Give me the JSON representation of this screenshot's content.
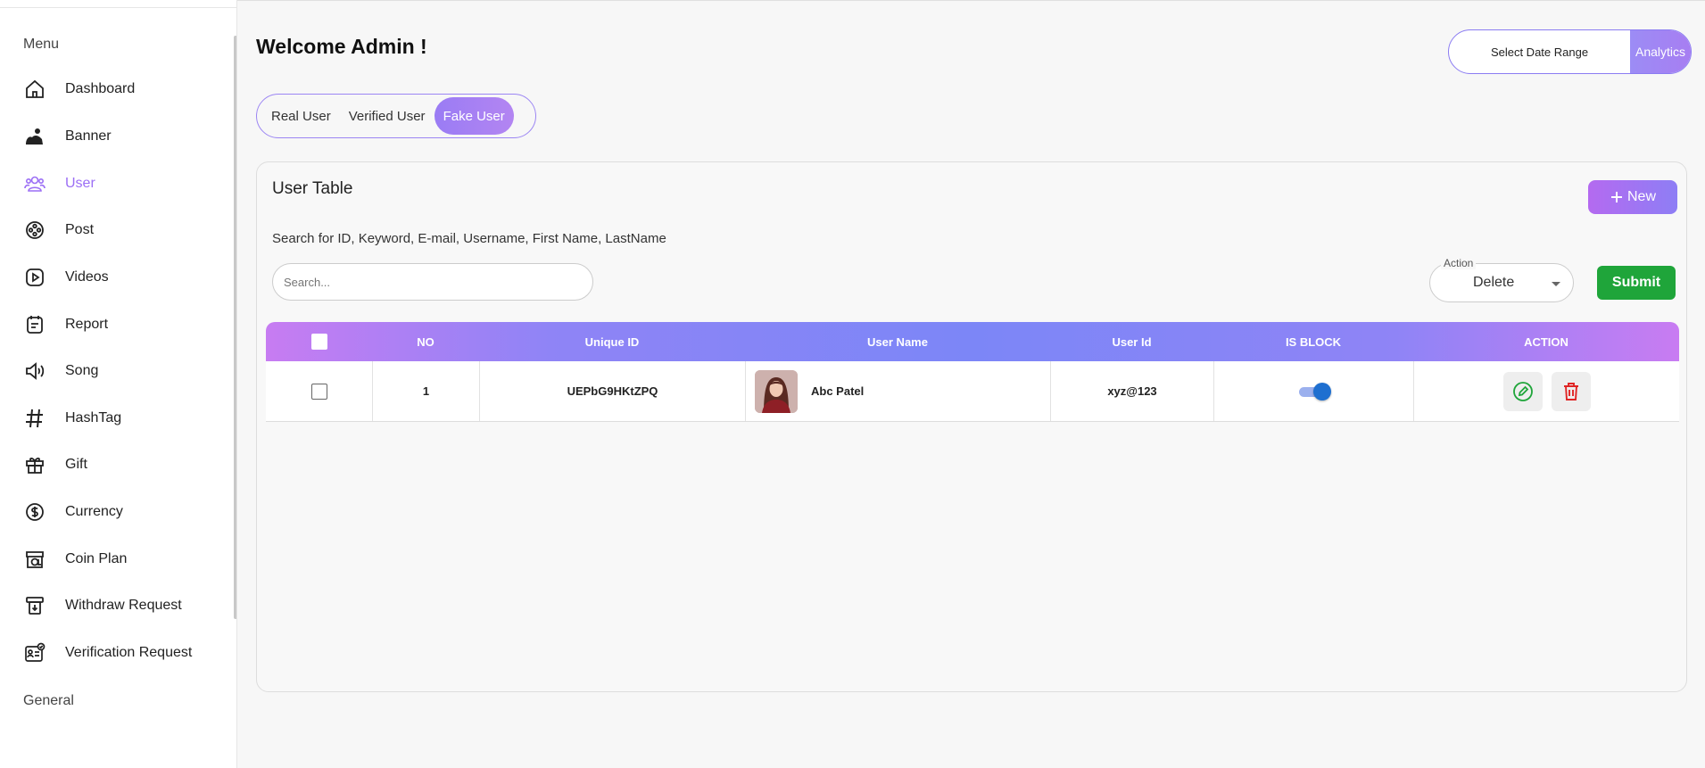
{
  "sidebar": {
    "menu_label": "Menu",
    "general_label": "General",
    "items": [
      {
        "label": "Dashboard",
        "icon": "home-icon"
      },
      {
        "label": "Banner",
        "icon": "image-icon"
      },
      {
        "label": "User",
        "icon": "users-icon",
        "active": true
      },
      {
        "label": "Post",
        "icon": "film-reel-icon"
      },
      {
        "label": "Videos",
        "icon": "play-icon"
      },
      {
        "label": "Report",
        "icon": "report-icon"
      },
      {
        "label": "Song",
        "icon": "speaker-icon"
      },
      {
        "label": "HashTag",
        "icon": "hashtag-icon"
      },
      {
        "label": "Gift",
        "icon": "gift-icon"
      },
      {
        "label": "Currency",
        "icon": "dollar-icon"
      },
      {
        "label": "Coin Plan",
        "icon": "coin-plan-icon"
      },
      {
        "label": "Withdraw Request",
        "icon": "withdraw-icon"
      },
      {
        "label": "Verification Request",
        "icon": "id-card-icon"
      }
    ]
  },
  "header": {
    "title": "Welcome Admin !",
    "date_range_label": "Select Date Range",
    "analytics_label": "Analytics"
  },
  "tabs": [
    {
      "label": "Real User",
      "active": false
    },
    {
      "label": "Verified User",
      "active": false
    },
    {
      "label": "Fake User",
      "active": true
    }
  ],
  "table_card": {
    "title": "User Table",
    "new_button": "New",
    "search_hint": "Search for ID, Keyword, E-mail, Username, First Name, LastName",
    "search_placeholder": "Search...",
    "action_label": "Action",
    "action_value": "Delete",
    "submit_label": "Submit",
    "columns": [
      "NO",
      "Unique ID",
      "User Name",
      "User Id",
      "IS BLOCK",
      "ACTION"
    ],
    "rows": [
      {
        "no": "1",
        "unique_id": "UEPbG9HKtZPQ",
        "user_name": "Abc Patel",
        "user_id": "xyz@123",
        "is_block": true
      }
    ]
  },
  "colors": {
    "accent": "#9c6ff5",
    "header_gradient_start": "#c77cf2",
    "header_gradient_mid": "#7c86f7",
    "submit_green": "#1fa53a",
    "delete_red": "#e02424",
    "toggle_blue": "#1e6fd0"
  }
}
